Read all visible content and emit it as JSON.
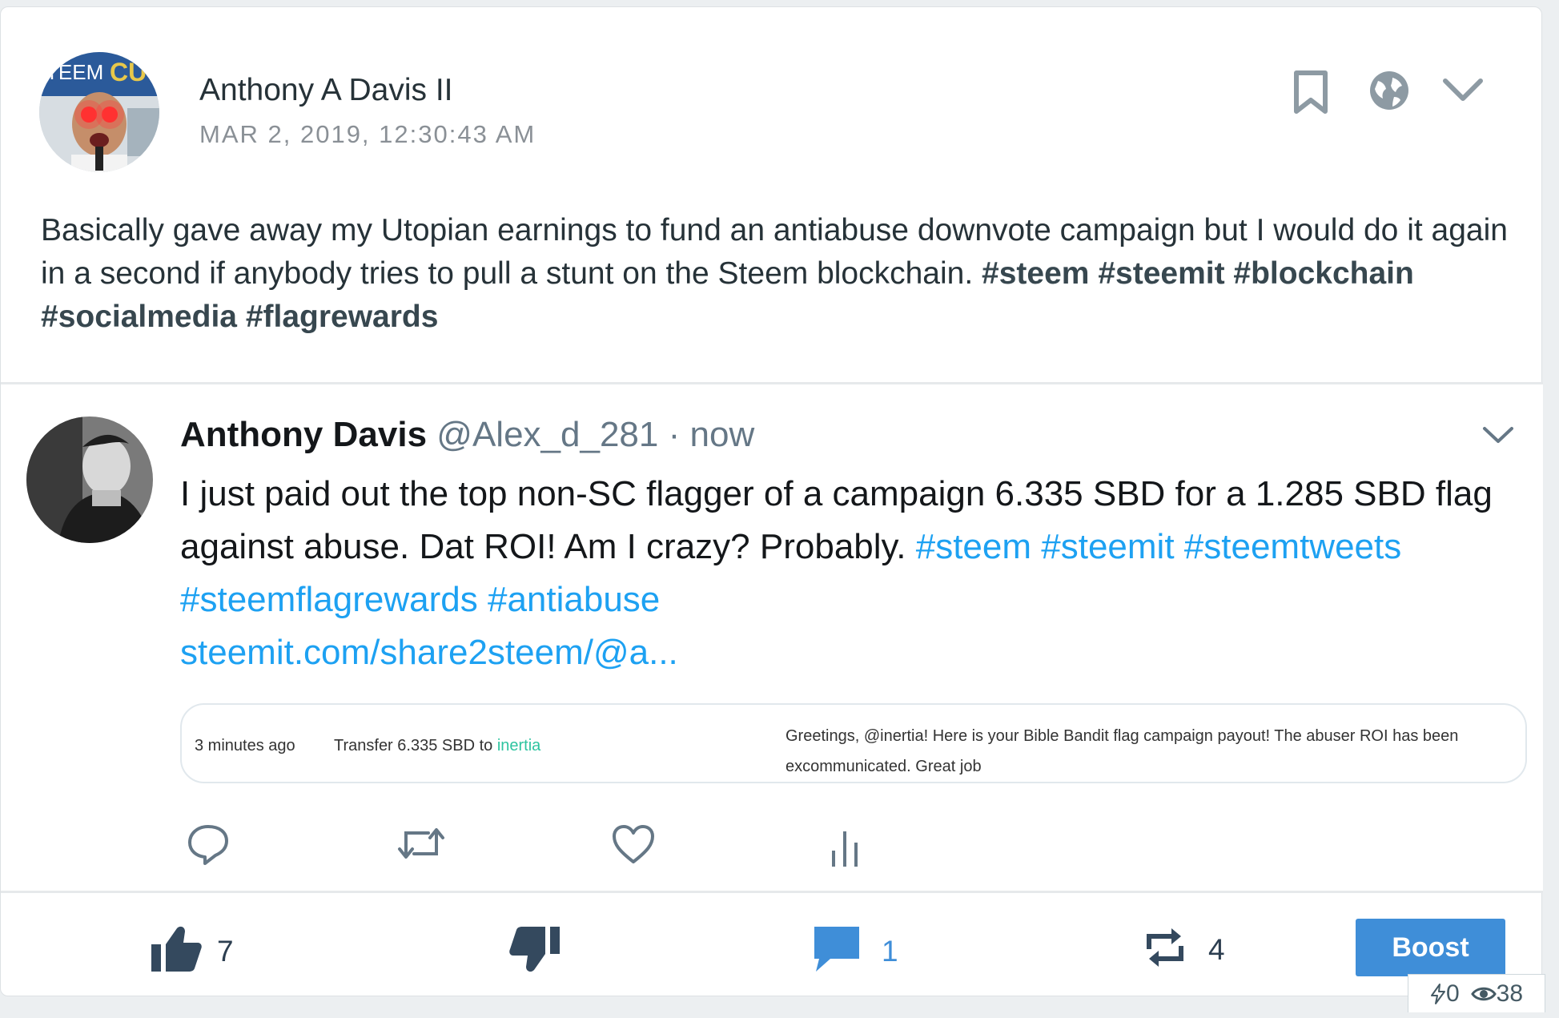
{
  "post": {
    "author": "Anthony A Davis II",
    "date": "MAR 2, 2019, 12:30:43 AM",
    "avatar_sign_text": "TEEM",
    "avatar_sign_text2": "CU",
    "body_text": "Basically gave away my Utopian earnings to fund an antiabuse downvote campaign but I would do it again in a second if anybody tries to pull a stunt on the Steem blockchain.",
    "hashtags": [
      "#steem",
      "#steemit",
      "#blockchain",
      "#socialmedia",
      "#flagrewards"
    ],
    "header_icons": [
      "bookmark-icon",
      "globe-icon",
      "chevron-down-icon"
    ]
  },
  "tweet": {
    "name": "Anthony Davis",
    "handle": "@Alex_d_281",
    "separator": "·",
    "time": "now",
    "text": "I just paid out the top non-SC flagger of a campaign 6.335 SBD for a 1.285 SBD flag against abuse. Dat ROI! Am I crazy? Probably.",
    "hashtags": [
      "#steem",
      "#steemit",
      "#steemtweets",
      "#steemflagrewards",
      "#antiabuse"
    ],
    "link": "steemit.com/share2steem/@a...",
    "card": {
      "time": "3 minutes ago",
      "transfer_prefix": "Transfer 6.335 SBD to",
      "transfer_user": "inertia",
      "memo": "Greetings, @inertia! Here is your Bible Bandit flag campaign payout! The abuser ROI has been excommunicated. Great job"
    },
    "action_icons": [
      "reply-icon",
      "retweet-icon",
      "like-icon",
      "analytics-icon"
    ]
  },
  "footer": {
    "upvotes": "7",
    "comments": "1",
    "reshares": "4",
    "boost_label": "Boost"
  },
  "stats": {
    "flags": "0",
    "views": "38"
  },
  "colors": {
    "twitter_link": "#1da1f2",
    "boost_button": "#3f8ed8",
    "transfer_user": "#2ec4a0"
  }
}
